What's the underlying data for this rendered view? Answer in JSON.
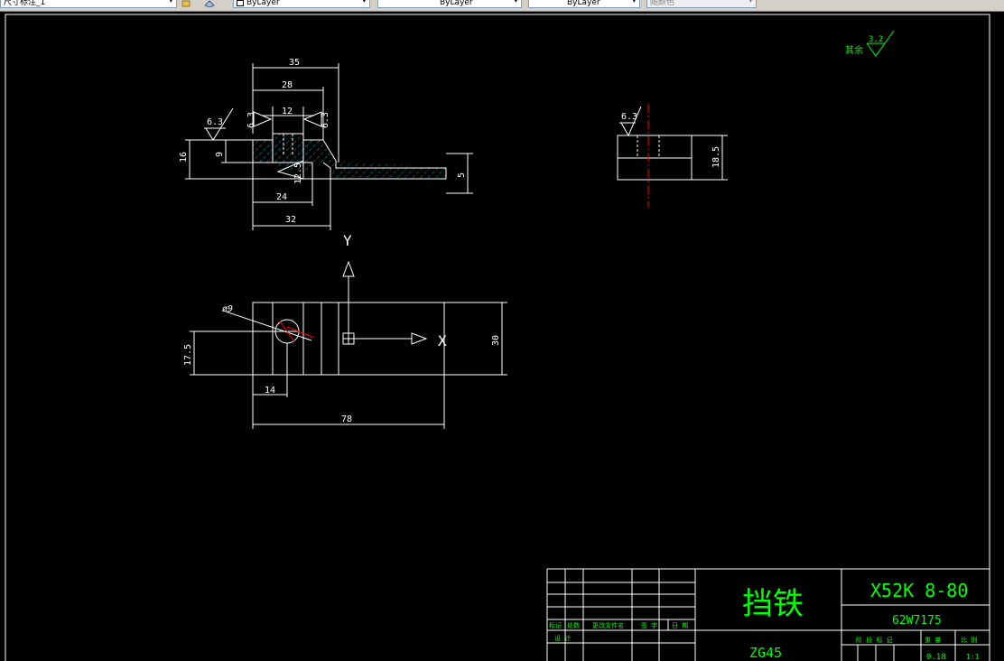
{
  "toolbar": {
    "layer_value": "尺寸标注_1",
    "color_value": "ByLayer",
    "linetype_value": "ByLayer",
    "lineweight_value": "ByLayer",
    "plotstyle_value": "随颜色"
  },
  "colors": {
    "background": "#000000",
    "geometry": "#ffffff",
    "text_green": "#00ff00",
    "centerline_red": "#ff0000",
    "hatch": "#00c8c8"
  },
  "drawing": {
    "roughness_note_prefix": "其余",
    "roughness_note_value": "3.2",
    "front_view": {
      "dims": {
        "d35": "35",
        "d28": "28",
        "d12": "12",
        "d24": "24",
        "d32": "32",
        "d16": "16",
        "d9": "9",
        "d5": "5"
      },
      "roughness": {
        "top_left": "6.3",
        "left_vert": "6.3",
        "right_vert": "6.3",
        "center": "12.5"
      }
    },
    "side_view": {
      "roughness": "6.3",
      "dims": {
        "d18_5": "18.5"
      }
    },
    "plan_view": {
      "axis_y": "Y",
      "axis_x": "X",
      "dims": {
        "phi": "ø9",
        "d17_5": "17.5",
        "d14": "14",
        "d78": "78",
        "d30": "30"
      }
    }
  },
  "title_block": {
    "part_name": "挡铁",
    "machine_code": "X52K  8-80",
    "drawing_number": "62W7175",
    "material": "ZG45",
    "rev_headers": [
      "标记",
      "处数",
      "更改文件名",
      "签 字",
      "日 期"
    ],
    "design_label": "设 计",
    "stage_label": "阶 段 标 记",
    "weight_label": "重 量",
    "scale_label": "比 例",
    "weight_value": "0.18",
    "scale_value": "1:1"
  }
}
